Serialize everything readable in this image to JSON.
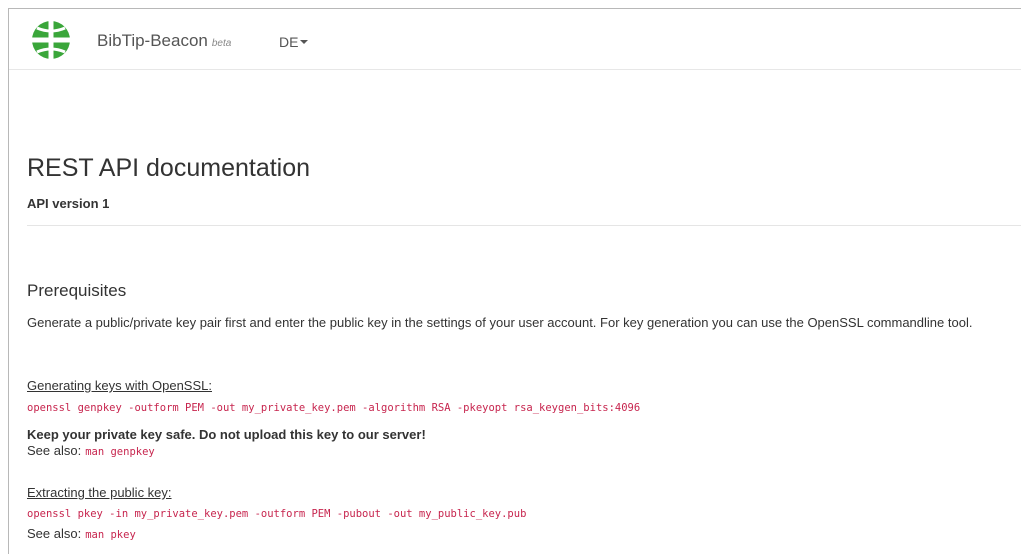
{
  "navbar": {
    "brand": "BibTip-Beacon",
    "beta": "beta",
    "language": "DE",
    "logo_icon": "globe-icon",
    "logo_color": "#3aa63a"
  },
  "header": {
    "title": "REST API documentation",
    "subtitle": "API version 1"
  },
  "prerequisites": {
    "heading": "Prerequisites",
    "description": "Generate a public/private key pair first and enter the public key in the settings of your user account. For key generation you can use the OpenSSL commandline tool.",
    "generating": {
      "label": "Generating keys with OpenSSL:",
      "command": "openssl genpkey -outform PEM -out my_private_key.pem -algorithm RSA -pkeyopt rsa_keygen_bits:4096",
      "warning": "Keep your private key safe. Do not upload this key to our server!",
      "see_also_label": "See also:",
      "see_also_command": "man genpkey"
    },
    "extracting": {
      "label": "Extracting the public key:",
      "command": "openssl pkey -in my_private_key.pem -outform PEM -pubout -out my_public_key.pub",
      "see_also_label": "See also:",
      "see_also_command": "man pkey"
    }
  },
  "colors": {
    "code": "#c7254e",
    "text": "#333333"
  }
}
